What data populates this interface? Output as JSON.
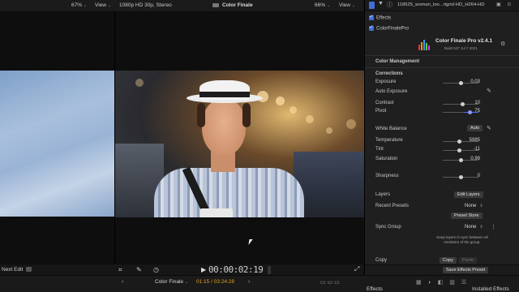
{
  "top_bar": {
    "zoom_left": "67%",
    "view_left": "View",
    "format": "1080p HD 30p, Stereo",
    "effect_name": "Color Finale",
    "zoom_right": "66%",
    "view_right": "View"
  },
  "inspector_header": {
    "filename": "118625_woman_loo...rtgrid-HD_H264-HD"
  },
  "inspector": {
    "effects_label": "Effects",
    "plugin_row": "ColorFinalePro",
    "plugin_title": "Color Finale Pro v2.4.1",
    "plugin_build": "Build 527 Jul 7 2021",
    "color_management": "Color Management",
    "corrections": "Corrections",
    "exposure_label": "Exposure",
    "exposure_value": "0,03",
    "auto_exposure_label": "Auto Exposure",
    "contrast_label": "Contrast",
    "contrast_value": "10",
    "pivot_label": "Pivot",
    "pivot_value": "75",
    "white_balance_label": "White Balance",
    "auto_button": "Auto",
    "temperature_label": "Temperature",
    "temperature_value": "5985",
    "tint_label": "Tint",
    "tint_value": "-11",
    "saturation_label": "Saturation",
    "saturation_value": "0,99",
    "sharpness_label": "Sharpness",
    "sharpness_value": "0",
    "layers_label": "Layers",
    "edit_layers_button": "Edit Layers",
    "recent_presets_label": "Recent Presets",
    "recent_presets_value": "None",
    "preset_store_button": "Preset Store",
    "sync_group_label": "Sync Group",
    "sync_group_value": "None",
    "sync_note": "Keep layers in-sync between all members of the group.",
    "copy_label": "Copy",
    "copy_button": "Copy",
    "paste_button": "Paste",
    "save_effects_preset": "Save Effects Preset"
  },
  "viewer": {
    "next_edit": "Next Edit",
    "timecode": "00:00:02:19"
  },
  "timeline": {
    "project": "Color Finale",
    "time": "01:15 / 03:24:28",
    "effects_label": "Effects",
    "installed_effects": "Installed Effects"
  },
  "colors": {
    "accent": "#3f6fd8",
    "background": "#141414",
    "inspector_bg": "#1f1f1f"
  }
}
